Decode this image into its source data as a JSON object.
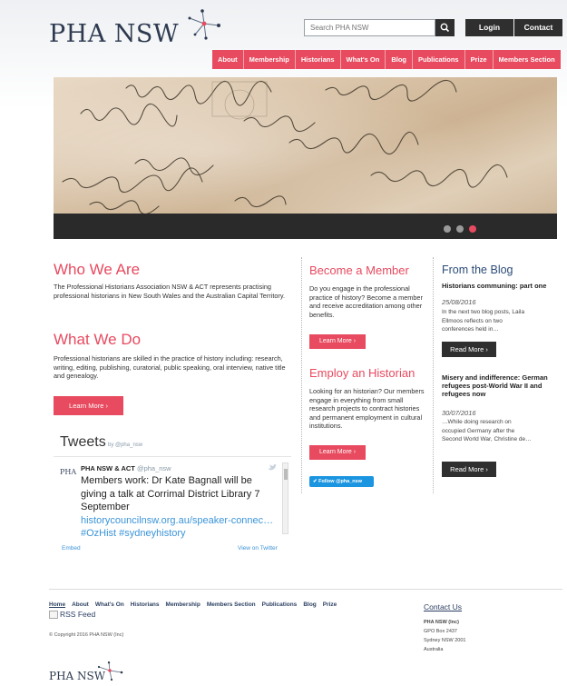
{
  "header": {
    "logo_text": "PHA NSW",
    "search_placeholder": "Search PHA NSW",
    "login_label": "Login",
    "contact_label": "Contact"
  },
  "nav": {
    "items": [
      "About",
      "Membership",
      "Historians",
      "What's On",
      "Blog",
      "Publications",
      "Prize",
      "Members Section"
    ]
  },
  "hero": {
    "slides_count": 3,
    "active_slide": 3
  },
  "who": {
    "title": "Who We Are",
    "text": "The Professional Historians Association NSW & ACT represents practising professional historians in New South Wales and the Australian Capital Territory."
  },
  "what": {
    "title": "What We Do",
    "text": "Professional historians are skilled in the practice of history including: research, writing, editing, publishing, curatorial, public speaking, oral interview, native title and genealogy.",
    "button": "Learn More ›"
  },
  "tweets": {
    "title": "Tweets",
    "by": "by @pha_nsw",
    "avatar_text": "PHA",
    "user": "PHA NSW & ACT",
    "handle": "@pha_nsw",
    "text": "Members work: Dr Kate Bagnall will be giving a talk at Corrimal District Library 7 September",
    "link": "historycouncilnsw.org.au/speaker-connec…",
    "hashtags": "#OzHist #sydneyhistory",
    "embed": "Embed",
    "view": "View on Twitter"
  },
  "member": {
    "title": "Become a Member",
    "text": "Do you engage in the professional practice of history? Become a member and receive accreditation among other benefits.",
    "button": "Learn More ›"
  },
  "employ": {
    "title": "Employ an Historian",
    "text": "Looking for an historian? Our members engage in everything from small research projects to contract histories and permanent employment in cultural institutions.",
    "button": "Learn More ›",
    "follow": "Follow @pha_nsw"
  },
  "blog": {
    "title": "From the Blog",
    "posts": [
      {
        "title": "Historians communing: part one",
        "date": "25/08/2016",
        "excerpt": "In the next two blog posts, Laila Ellmoos reflects on two conferences held in…",
        "button": "Read More ›"
      },
      {
        "title": "Misery and indifference: German refugees post-World War II and refugees now",
        "date": "30/07/2016",
        "excerpt": "…While doing research on occupied Germany after the Second World War, Christine de…",
        "button": "Read More ›"
      }
    ]
  },
  "footer": {
    "links": [
      "Home",
      "About",
      "What's On",
      "Historians",
      "Membership",
      "Members Section",
      "Publications",
      "Blog",
      "Prize"
    ],
    "rss": "RSS Feed",
    "copyright": "© Copyright 2016 PHA NSW (Inc)",
    "contact_title": "Contact Us",
    "address": [
      "PHA NSW (Inc)",
      "GPO Box 2437",
      "Sydney NSW 2001",
      "Australia"
    ],
    "logo_text": "PHA NSW"
  },
  "colors": {
    "accent": "#e84a5f",
    "navy": "#2b4b77",
    "dark": "#2f2f2f"
  }
}
